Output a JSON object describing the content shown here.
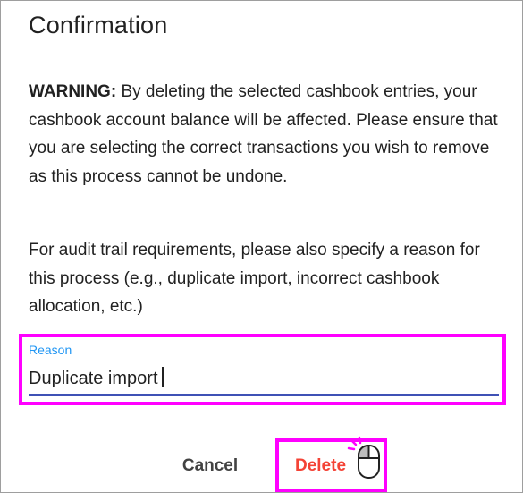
{
  "dialog": {
    "title": "Confirmation",
    "warning_label": "WARNING:",
    "warning_text": "By deleting the selected cashbook entries, your cashbook account balance will be affected. Please ensure that you are selecting the correct transactions you wish to remove as this process cannot be undone.",
    "audit_text": "For audit trail requirements, please also specify a reason for this process (e.g., duplicate import, incorrect cashbook allocation, etc.)"
  },
  "reason_field": {
    "label": "Reason",
    "value": "Duplicate import"
  },
  "actions": {
    "cancel_label": "Cancel",
    "delete_label": "Delete"
  },
  "colors": {
    "highlight": "#ff00ff",
    "field_label": "#2196f3",
    "field_underline": "#3f51b5",
    "delete_text": "#f44336"
  },
  "icons": {
    "cursor": "mouse-click-icon"
  }
}
